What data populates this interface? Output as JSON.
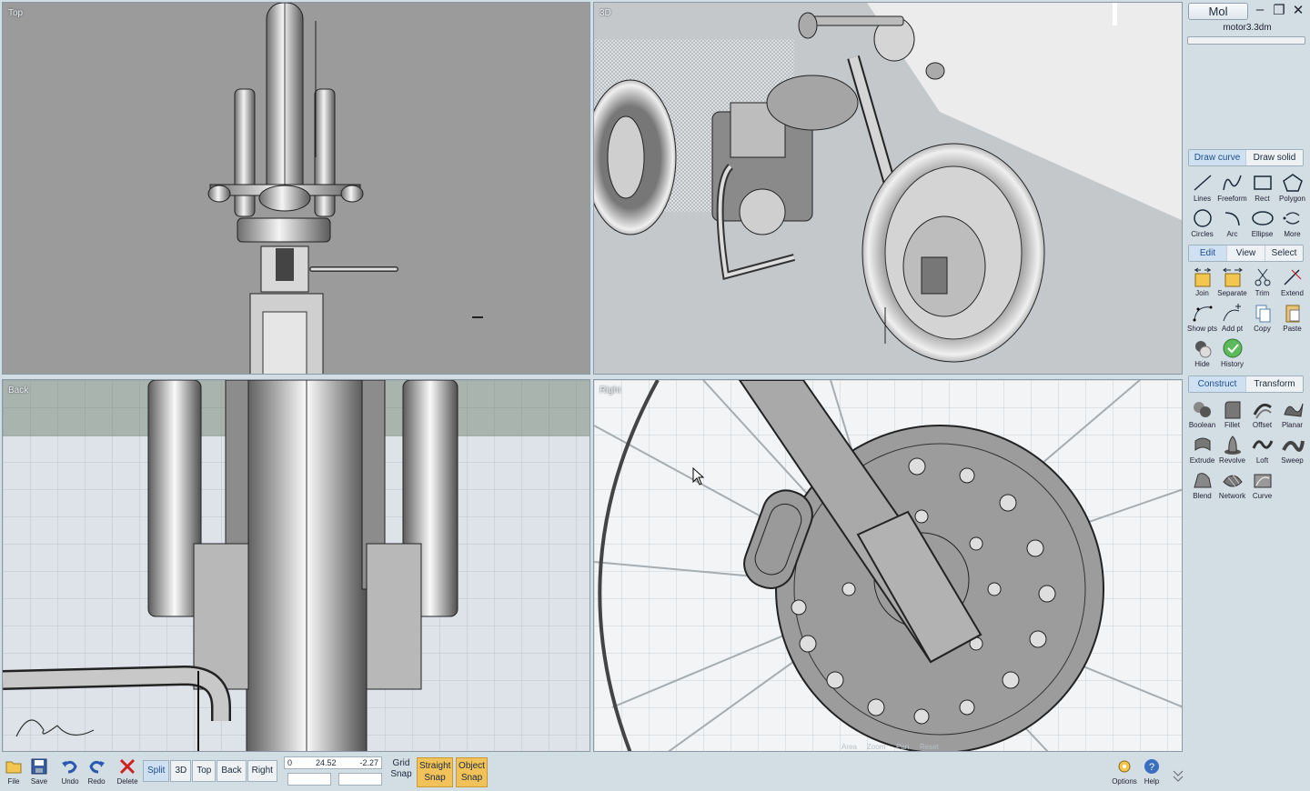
{
  "app": {
    "name": "Mol",
    "file": "motor3.3dm",
    "progress": 0
  },
  "viewports": {
    "top": "Top",
    "perspective": "3D",
    "back": "Back",
    "right": "Right",
    "nav_labels": [
      "Area",
      "Zoom",
      "Pan",
      "Reset"
    ]
  },
  "draw_tabs": {
    "curve": "Draw curve",
    "solid": "Draw solid"
  },
  "draw_tools": [
    {
      "label": "Lines",
      "icon": "line-icon"
    },
    {
      "label": "Freeform",
      "icon": "freeform-icon"
    },
    {
      "label": "Rect",
      "icon": "rect-icon"
    },
    {
      "label": "Polygon",
      "icon": "polygon-icon"
    },
    {
      "label": "Circles",
      "icon": "circle-icon"
    },
    {
      "label": "Arc",
      "icon": "arc-icon"
    },
    {
      "label": "Ellipse",
      "icon": "ellipse-icon"
    },
    {
      "label": "More",
      "icon": "more-icon"
    }
  ],
  "edit_tabs": {
    "edit": "Edit",
    "view": "View",
    "select": "Select"
  },
  "edit_tools": [
    {
      "label": "Join",
      "icon": "join-icon"
    },
    {
      "label": "Separate",
      "icon": "separate-icon"
    },
    {
      "label": "Trim",
      "icon": "trim-icon"
    },
    {
      "label": "Extend",
      "icon": "extend-icon"
    },
    {
      "label": "Show pts",
      "icon": "show-points-icon"
    },
    {
      "label": "Add pt",
      "icon": "add-point-icon"
    },
    {
      "label": "Copy",
      "icon": "copy-icon"
    },
    {
      "label": "Paste",
      "icon": "paste-icon"
    },
    {
      "label": "Hide",
      "icon": "hide-icon"
    },
    {
      "label": "History",
      "icon": "history-icon"
    }
  ],
  "construct_tabs": {
    "construct": "Construct",
    "transform": "Transform"
  },
  "construct_tools": [
    {
      "label": "Boolean",
      "icon": "boolean-icon"
    },
    {
      "label": "Fillet",
      "icon": "fillet-icon"
    },
    {
      "label": "Offset",
      "icon": "offset-icon"
    },
    {
      "label": "Planar",
      "icon": "planar-icon"
    },
    {
      "label": "Extrude",
      "icon": "extrude-icon"
    },
    {
      "label": "Revolve",
      "icon": "revolve-icon"
    },
    {
      "label": "Loft",
      "icon": "loft-icon"
    },
    {
      "label": "Sweep",
      "icon": "sweep-icon"
    },
    {
      "label": "Blend",
      "icon": "blend-icon"
    },
    {
      "label": "Network",
      "icon": "network-icon"
    },
    {
      "label": "Curve",
      "icon": "curve-icon"
    }
  ],
  "toolbar": {
    "file": "File",
    "save": "Save",
    "undo": "Undo",
    "redo": "Redo",
    "delete": "Delete",
    "views": [
      "Split",
      "3D",
      "Top",
      "Back",
      "Right"
    ],
    "coord_a": "0",
    "coord_b": "24.52",
    "coord_c": "-2.27",
    "grid_snap": [
      "Grid",
      "Snap"
    ],
    "straight_snap": [
      "Straight",
      "Snap"
    ],
    "object_snap": [
      "Object",
      "Snap"
    ],
    "options": "Options",
    "help": "Help"
  },
  "colors": {
    "accent": "#cfe0f2",
    "snap_on": "#f1c25a",
    "panel_bg": "#d3dde4"
  }
}
